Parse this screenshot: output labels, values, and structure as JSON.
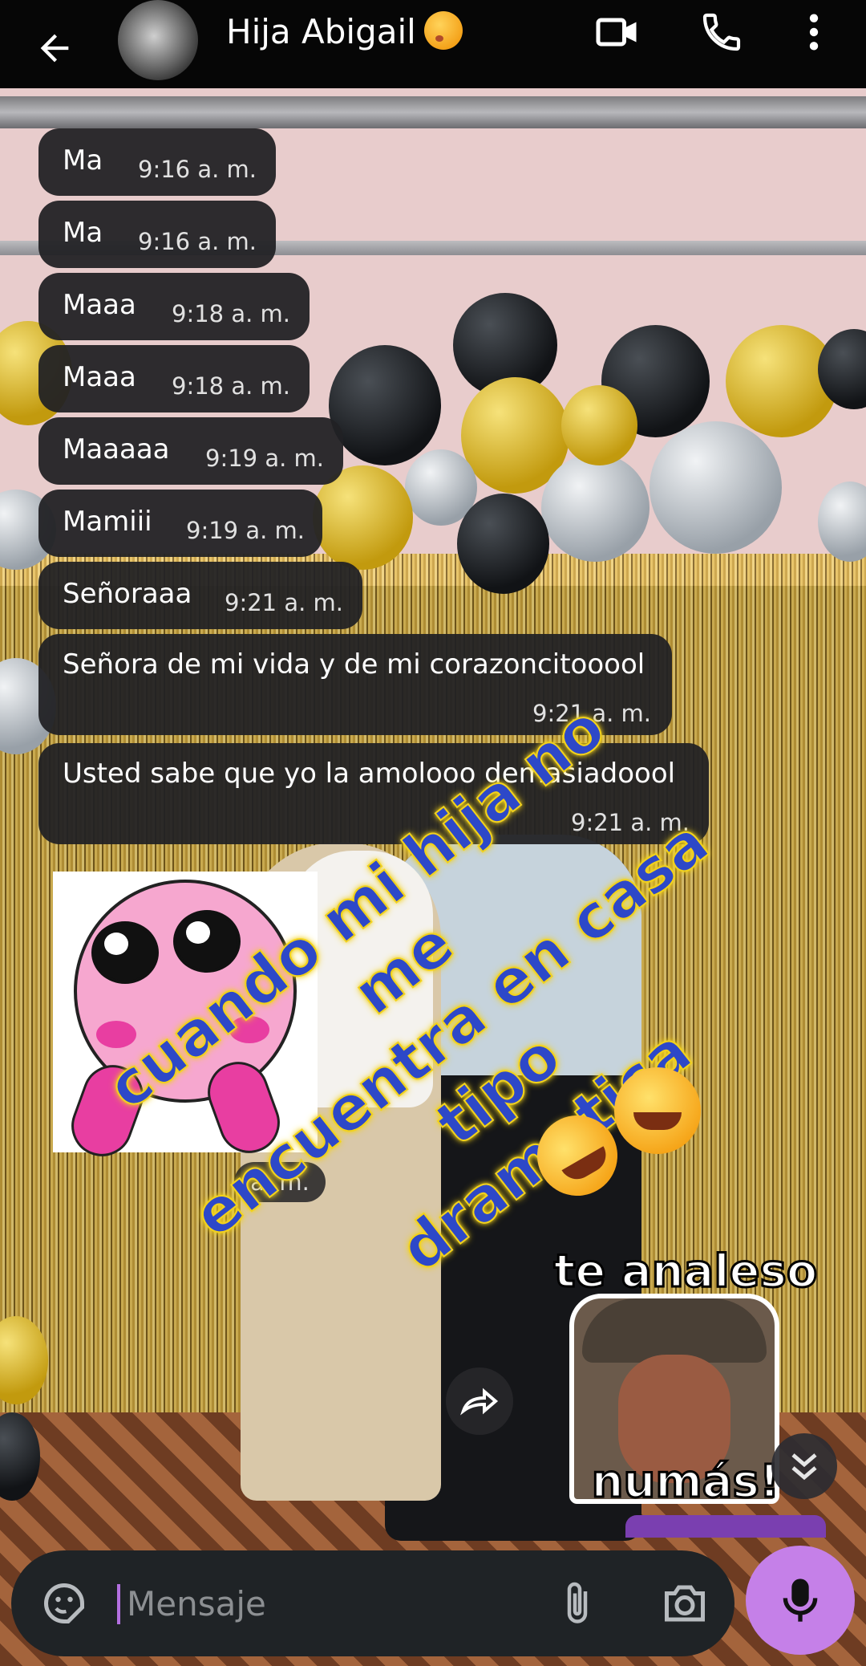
{
  "header": {
    "contact_name": "Hija Abigail",
    "back_icon": "arrow-left-icon",
    "video_icon": "video-camera-icon",
    "call_icon": "phone-icon",
    "menu_icon": "more-vert-icon"
  },
  "messages": [
    {
      "text": "Ma",
      "time": "9:16 a. m."
    },
    {
      "text": "Ma",
      "time": "9:16 a. m."
    },
    {
      "text": "Maaa",
      "time": "9:18 a. m."
    },
    {
      "text": "Maaa",
      "time": "9:18 a. m."
    },
    {
      "text": "Maaaaa",
      "time": "9:19 a. m."
    },
    {
      "text": "Mamiii",
      "time": "9:19 a. m."
    },
    {
      "text": "Señoraaa",
      "time": "9:21 a. m."
    },
    {
      "text": "Señora de mi vida y de mi corazoncitooool",
      "time": "9:21 a. m."
    },
    {
      "text": "Usted sabe que yo la amolooo demasiadoool",
      "time": "9:21 a. m."
    }
  ],
  "sticker_time_fragment": "a. m.",
  "overlay_caption": {
    "line1": "cuando mi hija no me",
    "line2": "encuentra en casa tipo",
    "line3": "dramatica"
  },
  "sticker_text": {
    "top": "te analeso",
    "bottom": "numás!"
  },
  "composer": {
    "placeholder": "Mensaje",
    "emoji_icon": "sticker-emoji-icon",
    "attach_icon": "paperclip-icon",
    "camera_icon": "camera-icon",
    "mic_icon": "microphone-icon"
  },
  "colors": {
    "header_bg": "#060606",
    "bubble_bg": "#212124",
    "mic_accent": "#c580e8",
    "caption_blue": "#2d48c8",
    "caption_yellow": "#f2d21b"
  }
}
